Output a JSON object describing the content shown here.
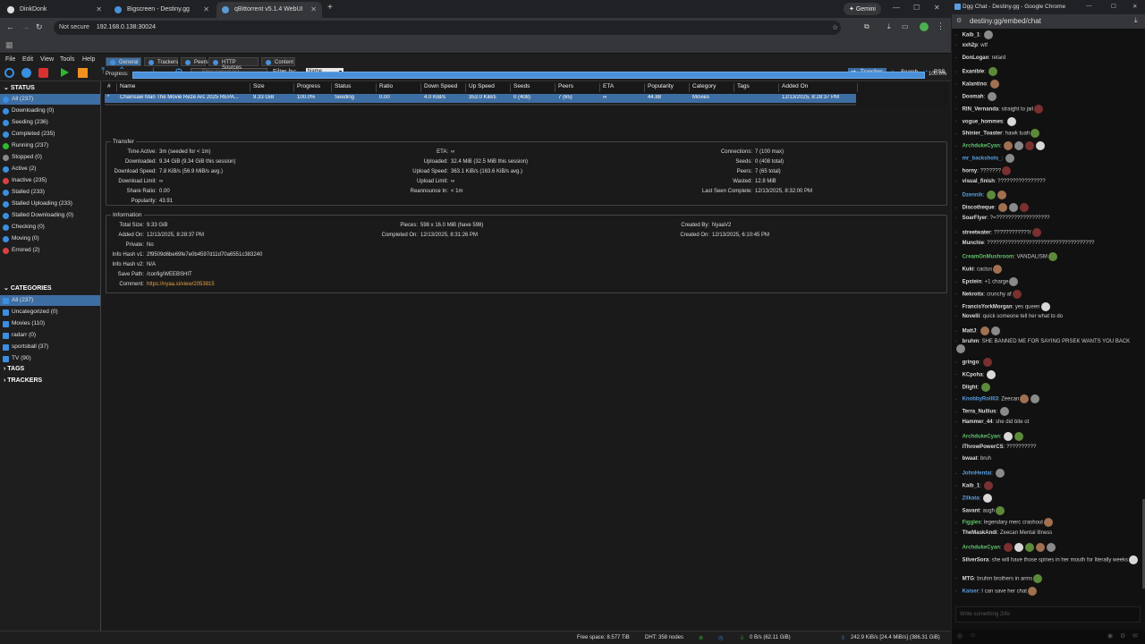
{
  "browser": {
    "tabs": [
      {
        "label": "DinkDonk"
      },
      {
        "label": "Bigscreen - Destiny.gg"
      },
      {
        "label": "qBittorrent v5.1.4 WebUI"
      }
    ],
    "gemini_label": "Gemini",
    "not_secure": "Not secure",
    "url": "192.168.0.138:30024"
  },
  "menu": [
    "File",
    "Edit",
    "View",
    "Tools",
    "Help"
  ],
  "toolbar": {
    "filter_placeholder": "Filter torrent list",
    "filter_by_label": "Filter by:",
    "filter_by_value": "Name",
    "transfers": "Transfers",
    "search": "Search",
    "rss": "RSS"
  },
  "sidebar": {
    "status_header": "STATUS",
    "status": [
      {
        "label": "All (237)",
        "color": "#3a8fe0"
      },
      {
        "label": "Downloading (0)",
        "color": "#3a8fe0"
      },
      {
        "label": "Seeding (236)",
        "color": "#3a8fe0"
      },
      {
        "label": "Completed (235)",
        "color": "#3a8fe0"
      },
      {
        "label": "Running (237)",
        "color": "#2fb82f"
      },
      {
        "label": "Stopped (0)",
        "color": "#888888"
      },
      {
        "label": "Active (2)",
        "color": "#3a8fe0"
      },
      {
        "label": "Inactive (235)",
        "color": "#d94040"
      },
      {
        "label": "Stalled (233)",
        "color": "#3a8fe0"
      },
      {
        "label": "Stalled Uploading (233)",
        "color": "#3a8fe0"
      },
      {
        "label": "Stalled Downloading (0)",
        "color": "#3a8fe0"
      },
      {
        "label": "Checking (0)",
        "color": "#3a8fe0"
      },
      {
        "label": "Moving (0)",
        "color": "#3a8fe0"
      },
      {
        "label": "Errored (2)",
        "color": "#d94040"
      }
    ],
    "categories_header": "CATEGORIES",
    "categories": [
      {
        "label": "All (237)"
      },
      {
        "label": "Uncategorized (0)"
      },
      {
        "label": "Movies (110)"
      },
      {
        "label": "radarr (0)"
      },
      {
        "label": "sportsball (37)"
      },
      {
        "label": "TV (90)"
      }
    ],
    "tags_header": "TAGS",
    "trackers_header": "TRACKERS"
  },
  "table": {
    "headers": [
      "#",
      "Name",
      "Size",
      "Progress",
      "Status",
      "Ratio",
      "Down Speed",
      "Up Speed",
      "Seeds",
      "Peers",
      "ETA",
      "Popularity",
      "Category",
      "Tags",
      "Added On"
    ],
    "row": [
      "*",
      "Chainsaw Man The Movie Reze Arc 2025 REPA...",
      "9.33 GiB",
      "100.0%",
      "Seeding",
      "0.00",
      "4.0 KiB/s",
      "353.0 KiB/s",
      "0 (408)",
      "7 (65)",
      "∞",
      "44.88",
      "Movies",
      "",
      "12/13/2025, 8:28:37 PM"
    ]
  },
  "details_tabs": [
    "General",
    "Trackers",
    "Peers",
    "HTTP Sources",
    "Content"
  ],
  "progress": {
    "label": "Progress:",
    "value": "100.0%",
    "fraction": 1.0
  },
  "transfer": {
    "title": "Transfer",
    "col1": [
      [
        "Time Active:",
        "3m (seeded for < 1m)"
      ],
      [
        "Downloaded:",
        "9.34 GiB (9.34 GiB this session)"
      ],
      [
        "Download Speed:",
        "7.8 KiB/s (56.9 MiB/s avg.)"
      ],
      [
        "Download Limit:",
        "∞"
      ],
      [
        "Share Ratio:",
        "0.00"
      ],
      [
        "Popularity:",
        "43.91"
      ]
    ],
    "col2": [
      [
        "ETA:",
        "∞"
      ],
      [
        "Uploaded:",
        "32.4 MiB (32.5 MiB this session)"
      ],
      [
        "Upload Speed:",
        "363.1 KiB/s (163.6 KiB/s avg.)"
      ],
      [
        "Upload Limit:",
        "∞"
      ],
      [
        "Reannounce In:",
        "< 1m"
      ]
    ],
    "col3": [
      [
        "Connections:",
        "7 (100 max)"
      ],
      [
        "Seeds:",
        "0 (408 total)"
      ],
      [
        "Peers:",
        "7 (65 total)"
      ],
      [
        "Wasted:",
        "12.8 MiB"
      ],
      [
        "Last Seen Complete:",
        "12/13/2025, 8:32:00 PM"
      ]
    ]
  },
  "information": {
    "title": "Information",
    "col1": [
      [
        "Total Size:",
        "9.33 GiB"
      ],
      [
        "Added On:",
        "12/13/2025, 8:28:37 PM"
      ],
      [
        "Private:",
        "No"
      ],
      [
        "Info Hash v1:",
        "2f9509d6be69fe7e0b4597d11d70a6551c383240"
      ],
      [
        "Info Hash v2:",
        "N/A"
      ],
      [
        "Save Path:",
        "/config/WEEBSHIT"
      ],
      [
        "Comment:",
        "https://nyaa.si/view/2053815"
      ]
    ],
    "col2": [
      [
        "Pieces:",
        "598 x 16.0 MiB (have 598)"
      ],
      [
        "Completed On:",
        "12/13/2025, 8:31:26 PM"
      ]
    ],
    "col3": [
      [
        "Created By:",
        "NyaaV2"
      ],
      [
        "Created On:",
        "12/13/2025, 6:10:45 PM"
      ]
    ]
  },
  "statusbar": {
    "free_space": "Free space: 8.577 TiB",
    "dht": "DHT: 358 nodes",
    "down": "0 B/s (62.11 GiB)",
    "up": "242.9 KiB/s [24.4 MiB/s] (386.31 GiB)"
  },
  "chat": {
    "window_title": "Dgg Chat - Destiny.gg - Google Chrome",
    "url": "destiny.gg/embed/chat",
    "input_placeholder": "Write something 2life",
    "messages": [
      {
        "user": "Kaib_1",
        "text": "",
        "style": "w",
        "emotes": 1
      },
      {
        "user": "xxh2p",
        "text": "wtf",
        "style": "w",
        "emotes": 0
      },
      {
        "user": "DonLogan",
        "text": "retard",
        "style": "w",
        "emotes": 0
      },
      {
        "user": "Exanible",
        "text": "",
        "style": "w",
        "emotes": 1
      },
      {
        "user": "Kalantino",
        "text": "",
        "style": "w",
        "emotes": 1
      },
      {
        "user": "Doomah",
        "text": "",
        "style": "w",
        "emotes": 1
      },
      {
        "user": "RIN_Vernanda",
        "text": "straight to jail",
        "style": "w",
        "emotes": 1
      },
      {
        "user": "vogue_hommes",
        "text": "",
        "style": "w",
        "emotes": 1
      },
      {
        "user": "Shinier_Toaster",
        "text": "hawk tuah",
        "style": "w",
        "emotes": 1
      },
      {
        "user": "ArchdukeCyan",
        "text": "",
        "style": "g",
        "emotes": 4
      },
      {
        "user": "mr_backshots_",
        "text": "",
        "style": "b",
        "emotes": 1
      },
      {
        "user": "horny",
        "text": "???????",
        "style": "w",
        "emotes": 1
      },
      {
        "user": "visual_finish",
        "text": "????????????????",
        "style": "w",
        "emotes": 0
      },
      {
        "user": "Dzennik",
        "text": "",
        "style": "b",
        "emotes": 2
      },
      {
        "user": "Discotheque",
        "text": "",
        "style": "w",
        "emotes": 3
      },
      {
        "user": "SoarFlyer",
        "text": "?=??????????????????",
        "style": "w",
        "emotes": 0
      },
      {
        "user": "streetwater",
        "text": "????????????/",
        "style": "w",
        "emotes": 1
      },
      {
        "user": "Munchie",
        "text": "????????????????????????????????????",
        "style": "w",
        "emotes": 0
      },
      {
        "user": "CreamOnMushroom",
        "text": "VANDALISM",
        "style": "g",
        "emotes": 1
      },
      {
        "user": "Kuki",
        "text": "cactus",
        "style": "w",
        "emotes": 1
      },
      {
        "user": "Epstein",
        "text": "+1 charge",
        "style": "w",
        "emotes": 1
      },
      {
        "user": "Nekrotix",
        "text": "crunchy af",
        "style": "w",
        "emotes": 1
      },
      {
        "user": "FrancisYorkMorgan",
        "text": "yes queen",
        "style": "w",
        "emotes": 1
      },
      {
        "user": "Novelli",
        "text": "quick someone tell her what to do",
        "style": "w",
        "emotes": 0
      },
      {
        "user": "MattJ",
        "text": "",
        "style": "w",
        "emotes": 2
      },
      {
        "user": "bruhm",
        "text": "SHE BANNED ME FOR SAYING PRSEK WANTS YOU BACK",
        "style": "w",
        "emotes": 1
      },
      {
        "user": "gringo",
        "text": "",
        "style": "w",
        "emotes": 1
      },
      {
        "user": "KCpoha",
        "text": "",
        "style": "w",
        "emotes": 1
      },
      {
        "user": "Dlight",
        "text": "",
        "style": "w",
        "emotes": 1
      },
      {
        "user": "KnobbyRoll03",
        "text": "Zeecan",
        "style": "b",
        "emotes": 2
      },
      {
        "user": "Terra_Nullius",
        "text": "",
        "style": "w",
        "emotes": 1
      },
      {
        "user": "Hammer_44",
        "text": "she did bite ot",
        "style": "w",
        "emotes": 0
      },
      {
        "user": "ArchdukeCyan",
        "text": "",
        "style": "g",
        "emotes": 2
      },
      {
        "user": "iThrowPowerCS",
        "text": "??????????",
        "style": "w",
        "emotes": 0
      },
      {
        "user": "bwaat",
        "text": "bruh",
        "style": "w",
        "emotes": 0
      },
      {
        "user": "JohnHentai",
        "text": "",
        "style": "b",
        "emotes": 1
      },
      {
        "user": "Kaib_1",
        "text": "",
        "style": "w",
        "emotes": 1
      },
      {
        "user": "Zilkata",
        "text": "",
        "style": "b",
        "emotes": 1
      },
      {
        "user": "Savant",
        "text": "augh",
        "style": "w",
        "emotes": 1
      },
      {
        "user": "Figgles",
        "text": "legendary merc crashout",
        "style": "g",
        "emotes": 1
      },
      {
        "user": "TheMaskAndi",
        "text": "Zeecan Mental Illness",
        "style": "w",
        "emotes": 0
      },
      {
        "user": "ArchdukeCyan",
        "text": "",
        "style": "g",
        "emotes": 5
      },
      {
        "user": "SilverSora",
        "text": "she will have those spines in her mouth for literally weeks",
        "style": "w",
        "emotes": 1
      },
      {
        "user": "MTG",
        "text": "bruhm brothers in arms",
        "style": "w",
        "emotes": 1
      },
      {
        "user": "Kaiser",
        "text": "I can save her chat",
        "style": "b",
        "emotes": 1
      }
    ]
  }
}
